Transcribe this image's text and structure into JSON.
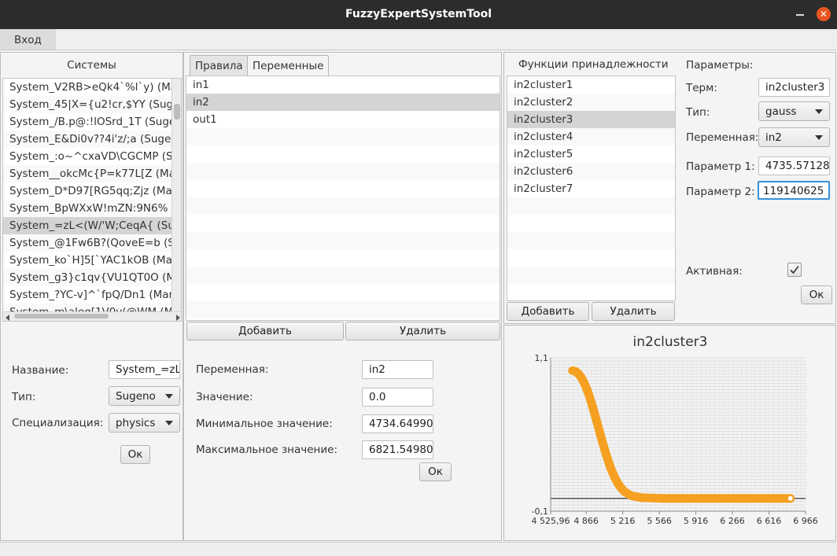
{
  "window": {
    "title": "FuzzyExpertSystemTool"
  },
  "menubar": {
    "login": "Вход"
  },
  "systems": {
    "header": "Системы",
    "items": [
      "System_V2RB>eQk4`%l`y) (Ma",
      "System_45|X={u2!cr,$YY (Suge",
      "System_/B.p@:!lOSrd_1T (Suge",
      "System_E&Di0v??4i'z/;a (Sugen",
      "System_:o~^cxaVD\\CGCMP (Su",
      "System__okcMc{P=k77L[Z (Ma",
      "System_D*D97[RG5qq;Zjz (Mar",
      "System_BpWXxW!mZN:9N6% (",
      "System_=zL<(W/'W;CeqA{ (Sug",
      "System_@1Fw6B?(QoveE=b (Su",
      "System_ko`H]5[`YAC1kOB (Mar",
      "System_g3}c1qv{VU1QT0O (M",
      "System_?YC-v]^`fpQ/Dn1 (Mam",
      "System_m\\aleg[1V0v(@WM (M"
    ],
    "selected_index": 8,
    "form": {
      "name_label": "Название:",
      "name_value": "System_=zL",
      "type_label": "Тип:",
      "type_value": "Sugeno",
      "spec_label": "Специализация:",
      "spec_value": "physics",
      "ok": "Ок"
    }
  },
  "middle": {
    "tabs": [
      "Правила",
      "Переменные"
    ],
    "active_tab": 1,
    "variables": [
      "in1",
      "in2",
      "out1"
    ],
    "selected_index": 1,
    "add": "Добавить",
    "delete": "Удалить",
    "form": {
      "var_label": "Переменная:",
      "var_value": "in2",
      "val_label": "Значение:",
      "val_value": "0.0",
      "min_label": "Минимальное значение:",
      "min_value": "4734.64990",
      "max_label": "Максимальное значение:",
      "max_value": "6821.54980",
      "ok": "Ок"
    }
  },
  "membership": {
    "header": "Функции принадлежности",
    "items": [
      "in2cluster1",
      "in2cluster2",
      "in2cluster3",
      "in2cluster4",
      "in2cluster5",
      "in2cluster6",
      "in2cluster7"
    ],
    "selected_index": 2,
    "add": "Добавить",
    "delete": "Удалить"
  },
  "params": {
    "header": "Параметры:",
    "term_label": "Терм:",
    "term_value": "in2cluster3",
    "type_label": "Тип:",
    "type_value": "gauss",
    "var_label": "Переменная:",
    "var_value": "in2",
    "p1_label": "Параметр 1:",
    "p1_value": "4735.57128",
    "p2_label": "Параметр 2:",
    "p2_value": "119140625",
    "active_label": "Активная:",
    "active_checked": true,
    "ok": "Ок"
  },
  "chart_data": {
    "type": "line",
    "title": "in2cluster3",
    "series_color": "#f5a020",
    "ylim": [
      -0.1,
      1.1
    ],
    "xlim": [
      4525.96,
      6966
    ],
    "y_ticks": [
      "1,1",
      "-0,1"
    ],
    "x_ticks": [
      "4 525,96",
      "4 866",
      "5 216",
      "5 566",
      "5 916",
      "6 266",
      "6 616",
      "6 966"
    ],
    "x_tick_values": [
      4525.96,
      4866,
      5216,
      5566,
      5916,
      6266,
      6616,
      6966
    ],
    "series": [
      {
        "x": [
          4735.57,
          4760,
          4780,
          4800,
          4820,
          4840,
          4860,
          4880,
          4900,
          4920,
          4940,
          4960,
          4980,
          5000,
          5020,
          5040,
          5060,
          5080,
          5100,
          5120,
          5140,
          5170,
          5200,
          5240,
          5300,
          5400,
          5600,
          5800,
          6000,
          6200,
          6400,
          6600,
          6821.55
        ],
        "y": [
          1.0,
          0.995,
          0.985,
          0.968,
          0.945,
          0.915,
          0.88,
          0.838,
          0.79,
          0.738,
          0.682,
          0.624,
          0.565,
          0.505,
          0.446,
          0.389,
          0.336,
          0.286,
          0.24,
          0.199,
          0.163,
          0.117,
          0.082,
          0.048,
          0.02,
          0.005,
          0.0,
          0.0,
          0.0,
          0.0,
          0.0,
          0.0,
          0.0
        ]
      }
    ]
  }
}
